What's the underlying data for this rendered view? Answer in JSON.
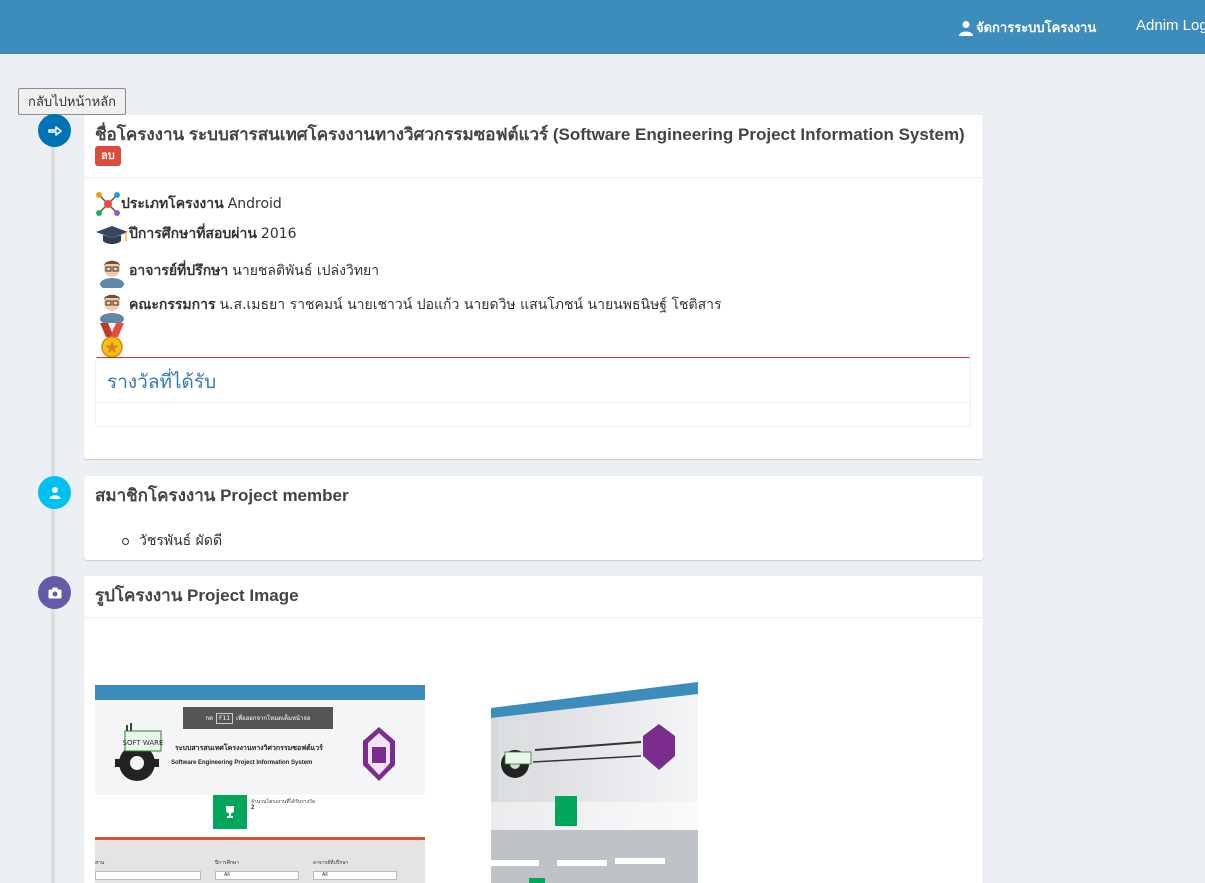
{
  "navbar": {
    "manage_label": "จัดการระบบโครงงาน",
    "admin_label": "Adnim Log",
    "bg_color": "#3c8dbc"
  },
  "back_button": {
    "label": "กลับไปหน้าหลัก"
  },
  "project": {
    "title_prefix": "ชื่อโครงงาน",
    "title": "ระบบสารสนเทศโครงงานทางวิศวกรรมซอฟต์แวร์ (Software Engineering Project Information System)",
    "delete_label": "ลบ",
    "type_label": "ประเภทโครงงาน",
    "type_value": "Android",
    "year_label": "ปีการศึกษาที่สอบผ่าน",
    "year_value": "2016",
    "advisor_label": "อาจารย์ที่ปรึกษา",
    "advisor_value": "นายชลติพันธ์ เปล่งวิทยา",
    "committee_label": "คณะกรรมการ",
    "committee_value": "น.ส.เมธยา ราชคมน์ นายเชาวน์ ปอแก้ว นายดวิษ แสนโภชน์ นายนพธนิษฐ์ โชติสาร",
    "award_heading": "รางวัลที่ได้รับ"
  },
  "members": {
    "heading": "สมาชิกโครงงาน Project member",
    "items": [
      "วัชรพันธ์ ผัดดี"
    ]
  },
  "images": {
    "heading": "รูปโครงงาน Project Image",
    "screenshot1": {
      "key_hint": "กด",
      "key": "F11",
      "hint_text": "เพื่อออกจากโหมดเต็มหน้าจอ",
      "system_th": "ระบบสารสนเทศโครงงานทางวิศวกรรมซอฟต์แวร์",
      "system_en": "Software Engineering Project Information System",
      "stat_label": "จำนวนโครงงานที่ได้รับรางวัล",
      "stat_value": "2",
      "filter1": "ปีการศึกษา",
      "filter2": "อาจารย์ที่ปรึกษา",
      "filter_all": "All",
      "logo_text": "SOFT WARE"
    }
  },
  "colors": {
    "icon_blue": "#0073b7",
    "icon_aqua": "#00c0ef",
    "icon_purple": "#605ca8",
    "danger": "#dd4b39",
    "link": "#337ab7"
  }
}
